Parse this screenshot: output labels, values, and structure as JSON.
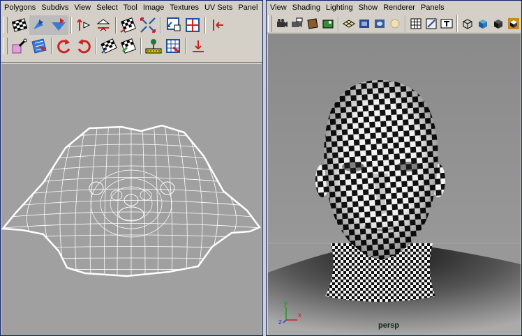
{
  "uv_editor": {
    "menu": [
      "Polygons",
      "Subdivs",
      "View",
      "Select",
      "Tool",
      "Image",
      "Textures",
      "UV Sets",
      "Panel"
    ],
    "toolbar_top": [
      "checker-map-icon",
      "flip-u-icon",
      "flip-v-icon",
      "mirror-u-icon",
      "mirror-v-icon",
      "uv-snapshot-icon",
      "layout-uvs-icon",
      "scale-uvs-icon",
      "split-uvs-icon",
      "move-left-icon"
    ],
    "toolbar_bottom": [
      "smudge-uv-icon",
      "select-shell-icon",
      "rotate-ccw-icon",
      "rotate-cw-icon",
      "unfold-uv-icon",
      "relax-uv-icon",
      "sew-uvs-icon",
      "grid-uv-icon",
      "move-down-icon"
    ]
  },
  "persp_view": {
    "menu": [
      "View",
      "Shading",
      "Lighting",
      "Show",
      "Renderer",
      "Panels"
    ],
    "toolbar": [
      "camera-icon",
      "camera-attr-icon",
      "bookmark-icon",
      "image-plane-icon",
      "grid-icon",
      "wireframe-icon",
      "smooth-shade-icon",
      "texture-icon",
      "shadow-icon",
      "xray-icon",
      "hud-icon",
      "cube-wire-icon",
      "cube-shaded-icon",
      "cube-textured-icon",
      "cube-lit-icon"
    ],
    "camera_label": "persp",
    "axis_labels": {
      "y": "y",
      "x": "x",
      "z": "z"
    }
  },
  "colors": {
    "uv_background": "#a0a0a0",
    "viewport_top": "#8f8f8f",
    "accent_blue": "#0a246a",
    "icon_red": "#cc2222"
  }
}
